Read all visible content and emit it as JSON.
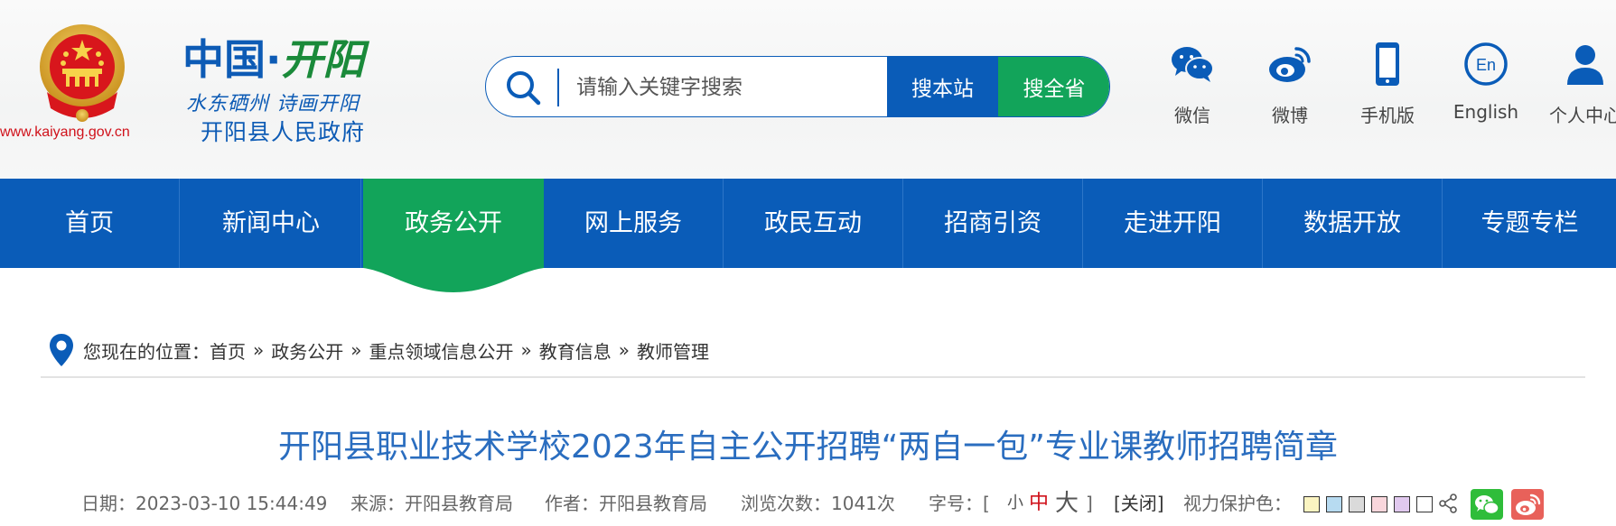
{
  "header": {
    "site_url": "www.kaiyang.gov.cn",
    "brand_part1": "中国",
    "brand_dot": "·",
    "brand_part2": "开阳",
    "slogan": "水东硒州 诗画开阳",
    "gov_name": "开阳县人民政府"
  },
  "search": {
    "placeholder": "请输入关键字搜索",
    "btn_site": "搜本站",
    "btn_province": "搜全省"
  },
  "quick_links": [
    {
      "label": "微信",
      "icon": "wechat-icon"
    },
    {
      "label": "微博",
      "icon": "weibo-icon"
    },
    {
      "label": "手机版",
      "icon": "mobile-icon"
    },
    {
      "label": "English",
      "icon": "english-icon"
    },
    {
      "label": "个人中心",
      "icon": "user-icon"
    }
  ],
  "nav": {
    "items": [
      "首页",
      "新闻中心",
      "政务公开",
      "网上服务",
      "政民互动",
      "招商引资",
      "走进开阳",
      "数据开放",
      "专题专栏"
    ],
    "active": "政务公开"
  },
  "breadcrumb": {
    "prefix": "您现在的位置：",
    "items": [
      "首页",
      "政务公开",
      "重点领域信息公开",
      "教育信息",
      "教师管理"
    ],
    "separator": "»"
  },
  "article": {
    "title": "开阳县职业技术学校2023年自主公开招聘“两自一包”专业课教师招聘简章",
    "date": "日期：2023-03-10 15:44:49",
    "source": "来源：开阳县教育局",
    "author": "作者：开阳县教育局",
    "views": "浏览次数：1041次",
    "font_label": "字号：[",
    "font_small": "小",
    "font_mid": "中",
    "font_large": "大",
    "font_close": "]",
    "close": "[关闭]",
    "eye_care": "视力保护色："
  },
  "colors": {
    "primary_blue": "#0a5cb8",
    "accent_green": "#12a45a",
    "title_blue": "#2a6dbf",
    "swatches": [
      "#fbf4c1",
      "#b7dbf1",
      "#dadada",
      "#f9d6dc",
      "#e1c9ef",
      "#ffffff"
    ]
  }
}
